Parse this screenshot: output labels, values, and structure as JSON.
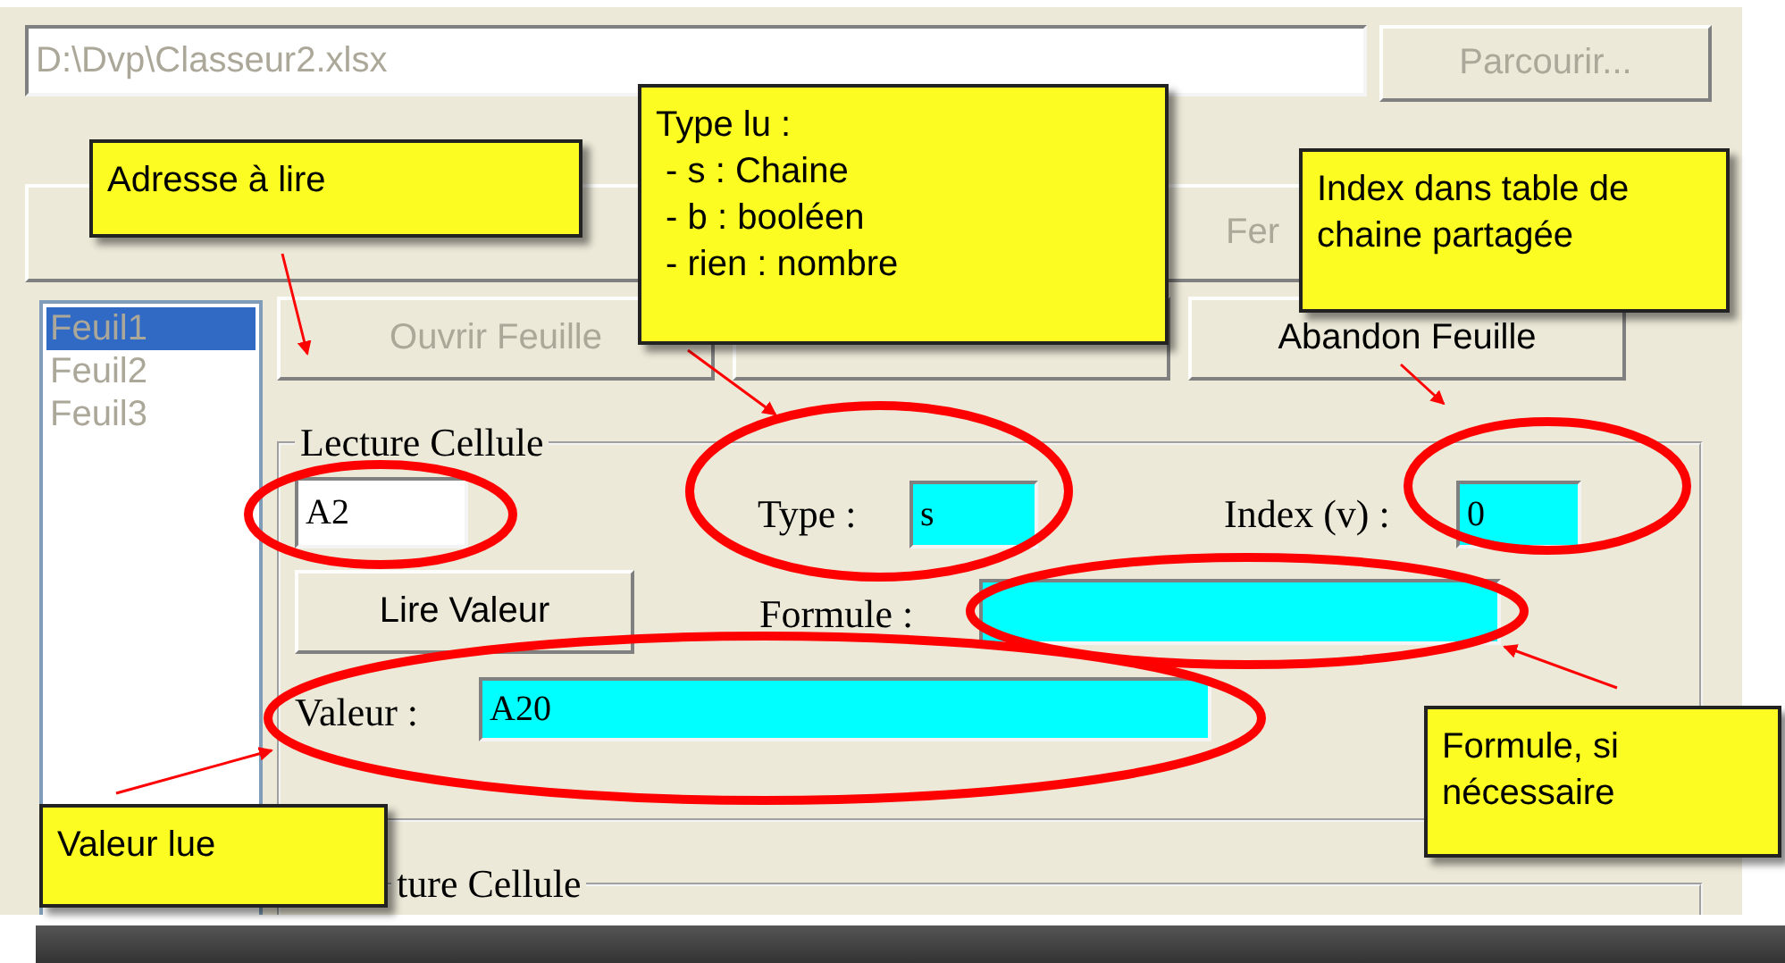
{
  "file_bar": {
    "path_field": {
      "value": "D:\\Dvp\\Classeur2.xlsx",
      "disabled": true
    },
    "browse_button": {
      "label": "Parcourir...",
      "disabled": true
    }
  },
  "workbook_buttons": [
    {
      "label": "Fer",
      "disabled": true
    }
  ],
  "sheet_list": {
    "disabled": true,
    "items": [
      {
        "label": "Feuil1",
        "selected": true
      },
      {
        "label": "Feuil2",
        "selected": false
      },
      {
        "label": "Feuil3",
        "selected": false
      }
    ]
  },
  "sheet_buttons": [
    {
      "label": "Ouvrir Feuille",
      "disabled": true
    },
    {
      "label": "Abandon Feuille",
      "disabled": false
    }
  ],
  "read_group": {
    "title": "Lecture Cellule",
    "address": {
      "value": "A2"
    },
    "type": {
      "label": "Type :",
      "value": "s"
    },
    "index": {
      "label": "Index (v) :",
      "value": "0"
    },
    "read_button": {
      "label": "Lire Valeur"
    },
    "formula": {
      "label": "Formule :"
    },
    "value": {
      "label": "Valeur :",
      "value": "A20"
    }
  },
  "write_group": {
    "title": "ture Cellule"
  },
  "annotations": [
    {
      "text": "Adresse à lire"
    },
    {
      "lines": [
        "Type lu :",
        " - s : Chaine",
        " - b : booléen",
        " - rien : nombre"
      ]
    },
    {
      "text": "Index dans table de chaine partagée"
    },
    {
      "text": "Formule, si nécessaire"
    },
    {
      "text": "Valeur lue"
    }
  ]
}
